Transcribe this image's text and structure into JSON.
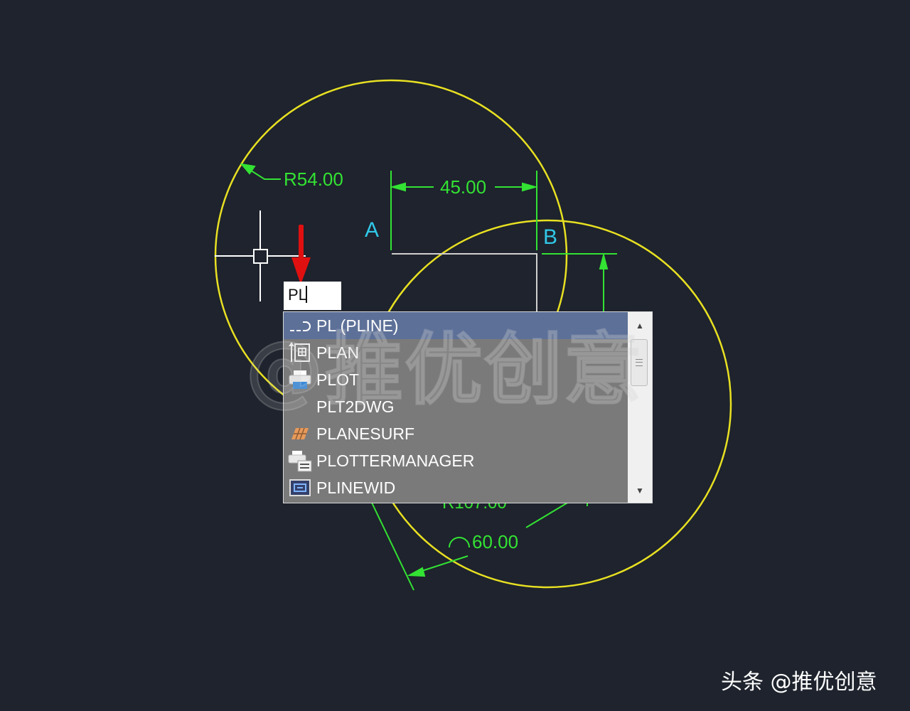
{
  "drawing": {
    "dim_radius_1": "R54.00",
    "dim_linear": "45.00",
    "dim_angle": "60.00",
    "dim_radius_2_partial": "R107.00",
    "point_a": "A",
    "point_b": "B",
    "colors": {
      "background": "#1e232d",
      "circle": "#e8e022",
      "dimension": "#33e233",
      "point_label": "#31c8e8",
      "arrow": "#e01010",
      "cursor": "#ffffff"
    }
  },
  "command_line": {
    "typed_text": "PL"
  },
  "autocomplete": {
    "selected_index": 0,
    "items": [
      {
        "label": "PL (PLINE)",
        "icon": "polyline-icon"
      },
      {
        "label": "PLAN",
        "icon": "plan-view-icon"
      },
      {
        "label": "PLOT",
        "icon": "printer-icon"
      },
      {
        "label": "PLT2DWG",
        "icon": ""
      },
      {
        "label": "PLANESURF",
        "icon": "planar-surface-icon"
      },
      {
        "label": "PLOTTERMANAGER",
        "icon": "plotter-manager-icon"
      },
      {
        "label": "PLINEWID",
        "icon": "pline-width-icon"
      }
    ]
  },
  "watermark": "@推优创意",
  "footer_brand": "头条 @推优创意"
}
